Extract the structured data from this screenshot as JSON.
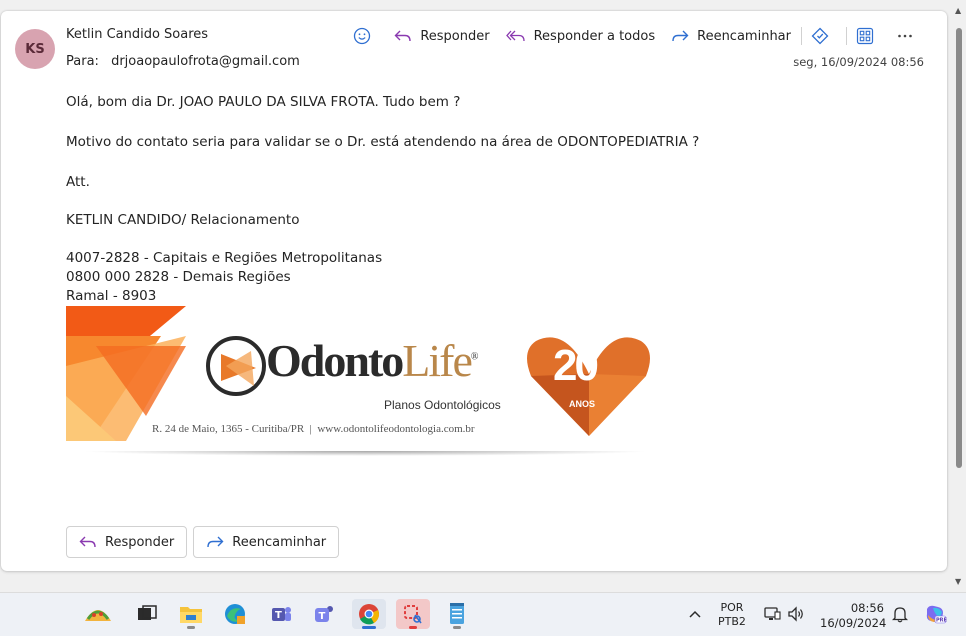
{
  "email": {
    "avatar_initials": "KS",
    "sender_name": "Ketlin Candido Soares",
    "to_label": "Para:",
    "to_address": "drjoaopaulofrota@gmail.com",
    "date": "seg, 16/09/2024 08:56",
    "actions": {
      "reply": "Responder",
      "reply_all": "Responder a todos",
      "forward": "Reencaminhar"
    },
    "body": {
      "greeting": "Olá, bom dia Dr. JOAO PAULO DA SILVA FROTA. Tudo bem ?",
      "motive": "Motivo do contato seria para validar se o Dr. está atendendo na área de ODONTOPEDIATRIA ?",
      "att": "Att.",
      "signature_name": "KETLIN CANDIDO/ Relacionamento",
      "phone1": "4007-2828 - Capitais e Regiões Metropolitanas",
      "phone2": "0800 000 2828 - Demais Regiões",
      "ramal": "Ramal - 8903"
    },
    "banner": {
      "brand_odonto": "Odonto",
      "brand_life": "Life",
      "registered": "®",
      "tagline": "Planos Odontológicos",
      "address": "R. 24 de Maio, 1365 - Curitiba/PR  |  www.odontolifeodontologia.com.br",
      "anniversary_number": "20",
      "anniversary_word": "ANOS"
    },
    "footer": {
      "reply": "Responder",
      "forward": "Reencaminhar"
    }
  },
  "taskbar": {
    "lang_top": "POR",
    "lang_bottom": "PTB2",
    "time": "08:56",
    "date": "16/09/2024"
  },
  "colors": {
    "accent": "#2f6fd1",
    "reply_purple": "#8a3ab0",
    "brand_orange": "#e8792a",
    "brand_dark": "#2b2b2b",
    "brand_gold": "#b9874a"
  }
}
